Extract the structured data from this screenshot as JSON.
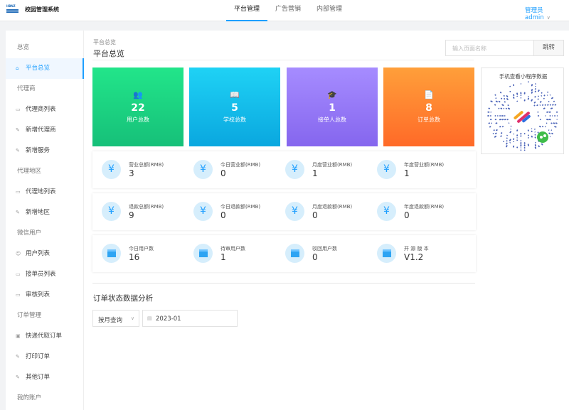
{
  "header": {
    "logo_text": "HBNZ",
    "brand": "校园管理系统",
    "nav": [
      "平台管理",
      "广告营销",
      "内部管理"
    ],
    "admin": "管理员 admin"
  },
  "sidebar": {
    "items": [
      {
        "label": "总览",
        "type": "group"
      },
      {
        "label": "平台总览",
        "type": "item",
        "icon": "home-icon",
        "active": true
      },
      {
        "label": "代理商",
        "type": "group"
      },
      {
        "label": "代理商列表",
        "type": "item",
        "icon": "list-icon"
      },
      {
        "label": "新增代理商",
        "type": "item",
        "icon": "edit-icon"
      },
      {
        "label": "新增服务",
        "type": "item",
        "icon": "edit-icon"
      },
      {
        "label": "代理地区",
        "type": "group"
      },
      {
        "label": "代理地列表",
        "type": "item",
        "icon": "list-icon"
      },
      {
        "label": "新增地区",
        "type": "item",
        "icon": "edit-icon"
      },
      {
        "label": "微信用户",
        "type": "group"
      },
      {
        "label": "用户列表",
        "type": "item",
        "icon": "user-icon"
      },
      {
        "label": "接单员列表",
        "type": "item",
        "icon": "list-icon"
      },
      {
        "label": "审核列表",
        "type": "item",
        "icon": "list-icon"
      },
      {
        "label": "订单管理",
        "type": "group"
      },
      {
        "label": "快递代取订单",
        "type": "item",
        "icon": "box-icon"
      },
      {
        "label": "打印订单",
        "type": "item",
        "icon": "edit-icon"
      },
      {
        "label": "其他订单",
        "type": "item",
        "icon": "edit-icon"
      },
      {
        "label": "我的账户",
        "type": "group"
      }
    ]
  },
  "page": {
    "breadcrumb": "平台总览",
    "title": "平台总览",
    "search_placeholder": "输入页面名称",
    "jump_label": "跳转"
  },
  "stat_cards": [
    {
      "value": "22",
      "label": "用户总数",
      "icon": "users-icon",
      "glyph": "👥"
    },
    {
      "value": "5",
      "label": "学校总数",
      "icon": "book-icon",
      "glyph": "📖"
    },
    {
      "value": "1",
      "label": "接单人总数",
      "icon": "graduation-cap-icon",
      "glyph": "🎓"
    },
    {
      "value": "8",
      "label": "订单总数",
      "icon": "document-icon",
      "glyph": "📄"
    }
  ],
  "qr": {
    "title": "手机查看小程序数据"
  },
  "metrics": [
    [
      {
        "label": "营业总额(RMB)",
        "value": "3",
        "icon": "yuan-icon"
      },
      {
        "label": "今日营业额(RMB)",
        "value": "0",
        "icon": "yuan-icon"
      },
      {
        "label": "月度营业额(RMB)",
        "value": "1",
        "icon": "yuan-icon"
      },
      {
        "label": "年度营业额(RMB)",
        "value": "1",
        "icon": "yuan-icon"
      }
    ],
    [
      {
        "label": "退款总额(RMB)",
        "value": "9",
        "icon": "yuan-icon"
      },
      {
        "label": "今日退款额(RMB)",
        "value": "0",
        "icon": "yuan-icon"
      },
      {
        "label": "月度退款额(RMB)",
        "value": "0",
        "icon": "yuan-icon"
      },
      {
        "label": "年度退款额(RMB)",
        "value": "0",
        "icon": "yuan-icon"
      }
    ],
    [
      {
        "label": "今日用户数",
        "value": "16",
        "icon": "window-icon"
      },
      {
        "label": "待审用户数",
        "value": "1",
        "icon": "window-icon"
      },
      {
        "label": "驳回用户数",
        "value": "0",
        "icon": "window-icon"
      },
      {
        "label": "开 源 版 本",
        "value": "V1.2",
        "icon": "window-icon"
      }
    ]
  ],
  "analysis": {
    "title": "订单状态数据分析",
    "query_mode": "按月查询",
    "date": "2023-01"
  }
}
